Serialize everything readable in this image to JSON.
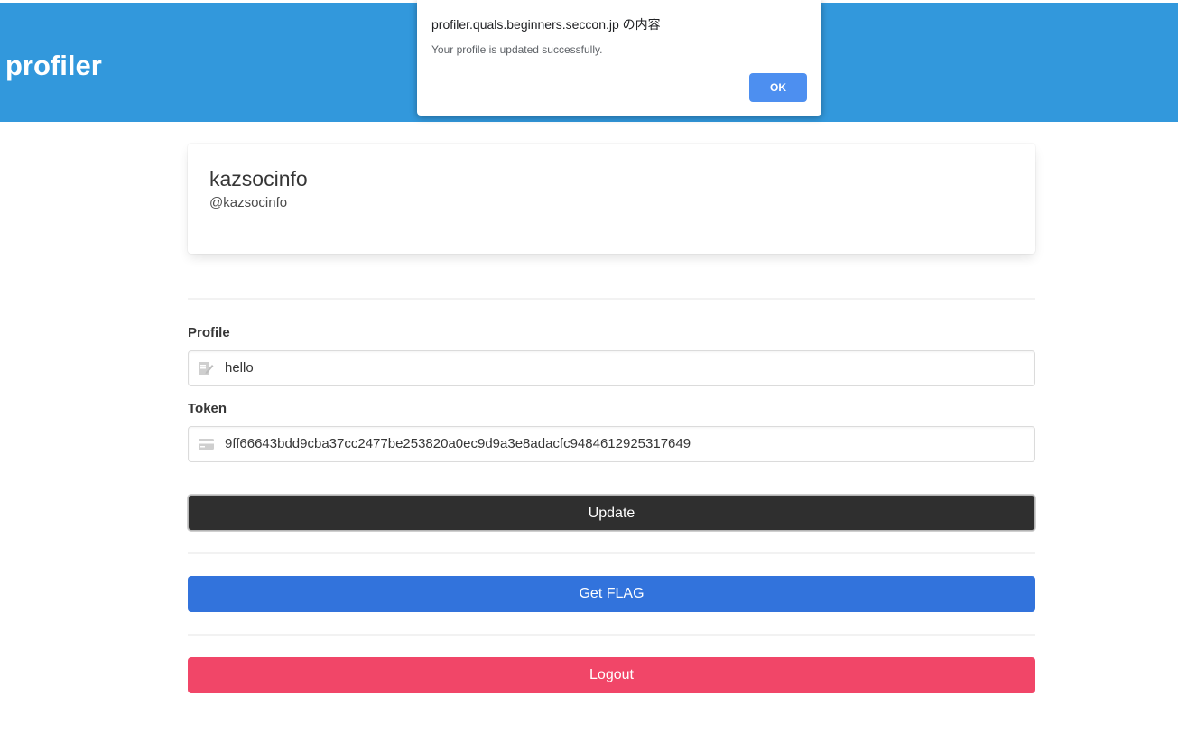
{
  "header": {
    "title": "profiler"
  },
  "profile_card": {
    "name": "kazsocinfo",
    "handle": "@kazsocinfo"
  },
  "form": {
    "profile_label": "Profile",
    "profile_value": "hello",
    "profile_icon": "edit-icon",
    "token_label": "Token",
    "token_value": "9ff66643bdd9cba37cc2477be253820a0ec9d9a3e8adacfc9484612925317649",
    "token_icon": "card-icon",
    "update_label": "Update"
  },
  "actions": {
    "get_flag_label": "Get FLAG",
    "logout_label": "Logout"
  },
  "dialog": {
    "title": "profiler.quals.beginners.seccon.jp の内容",
    "message": "Your profile is updated successfully.",
    "ok_label": "OK"
  },
  "colors": {
    "header": "#3298dc",
    "update_button": "#2f2f2f",
    "flag_button": "#3273dc",
    "logout_button": "#f14668",
    "dialog_ok": "#4d8ff0"
  }
}
